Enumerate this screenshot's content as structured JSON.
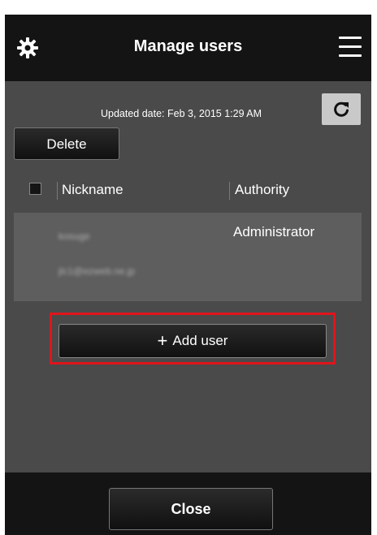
{
  "header": {
    "title": "Manage users",
    "settings_icon": "gear-icon",
    "menu_icon": "hamburger-menu-icon"
  },
  "status": {
    "updated_text": "Updated date: Feb 3, 2015 1:29 AM",
    "refresh_icon": "refresh-icon"
  },
  "toolbar": {
    "delete_label": "Delete"
  },
  "table": {
    "columns": [
      "Nickname",
      "Authority"
    ],
    "rows": [
      {
        "nickname": "kosuge",
        "authority": "Administrator",
        "email": "jlc1@ezweb.ne.jp"
      }
    ]
  },
  "actions": {
    "add_user_label": "Add user",
    "add_icon": "plus-icon",
    "close_label": "Close"
  },
  "colors": {
    "bar": "#141414",
    "body": "#4a4a4a",
    "highlight": "#e0141b",
    "refresh_bg": "#c9c9c9"
  }
}
